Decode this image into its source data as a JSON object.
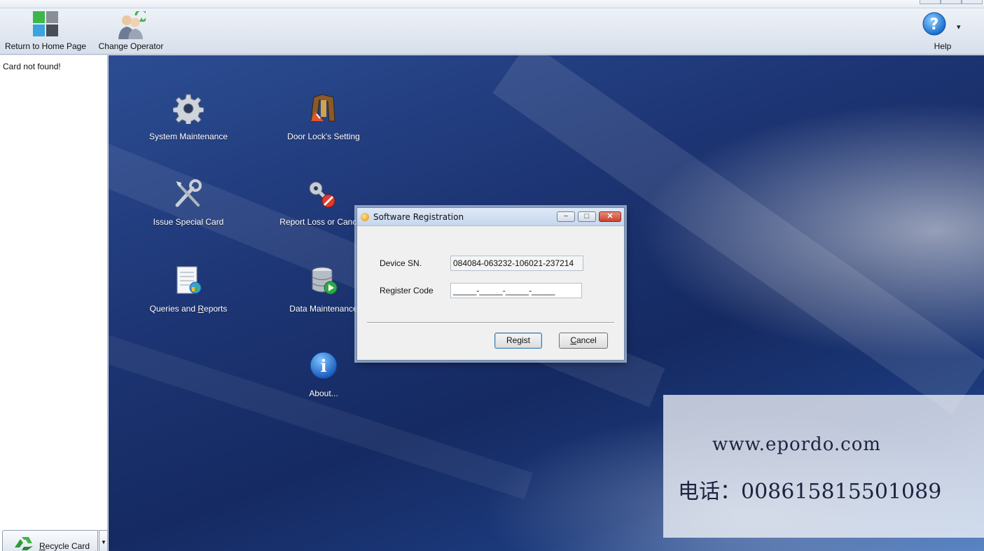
{
  "toolbar": {
    "home_label": "Return to Home Page",
    "operator_label": "Change Operator",
    "help_label": "Help",
    "help_dropdown_glyph": "▾"
  },
  "left_panel": {
    "status": "Card not found!",
    "recycle_prefix": "R",
    "recycle_rest": "ecycle Card"
  },
  "menu": {
    "system_maintenance": "System Maintenance",
    "door_lock_setting": "Door Lock's Setting",
    "issue_special_card": "Issue Special Card",
    "report_loss": "Report Loss or Cancel",
    "queries_prefix": "Queries and ",
    "queries_underlined": "R",
    "queries_rest": "eports",
    "data_maintenance": "Data Maintenance",
    "about": "About..."
  },
  "dialog": {
    "title": "Software Registration",
    "device_sn_label": "Device SN.",
    "device_sn_value": "084084-063232-106021-237214",
    "register_code_label": "Register Code",
    "register_code_value": "_____-_____-_____-_____",
    "regist_label": "Regist",
    "cancel_underlined": "C",
    "cancel_rest": "ancel",
    "min_glyph": "−",
    "max_glyph": "□",
    "close_glyph": "✕"
  },
  "watermark": {
    "url": "www.epordo.com",
    "phone": "电话：008615815501089"
  },
  "icons": {
    "home": "home-grid-icon",
    "operator": "operator-icon",
    "help": "help-icon",
    "system": "gear-icon",
    "door": "door-lock-icon",
    "issue": "tools-icon",
    "report": "key-cancel-icon",
    "queries": "report-icon",
    "data": "database-icon",
    "about": "info-icon",
    "recycle": "recycle-icon"
  },
  "colors": {
    "background_blue": "#1d3574",
    "toolbar": "#dde4ef",
    "dialog": "#f0f0f0",
    "close_button": "#c8442c"
  }
}
